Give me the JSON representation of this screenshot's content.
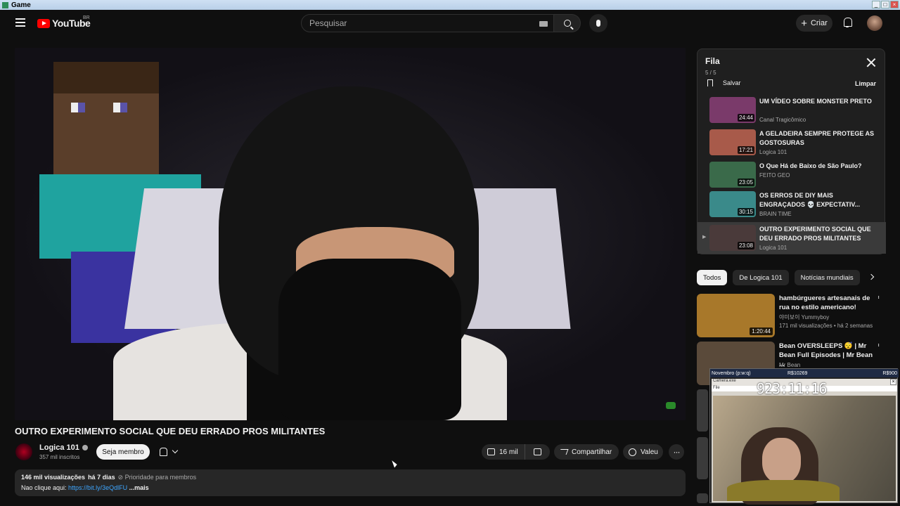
{
  "window": {
    "title": "Game"
  },
  "masthead": {
    "logo_text": "YouTube",
    "country_code": "BR",
    "search_placeholder": "Pesquisar",
    "create_label": "Criar"
  },
  "video": {
    "title": "OUTRO EXPERIMENTO SOCIAL QUE DEU ERRADO PROS MILITANTES",
    "channel_name": "Logica 101",
    "subscribers": "357 mil inscritos",
    "member_button": "Seja membro",
    "likes": "16 mil",
    "share_label": "Compartilhar",
    "thanks_label": "Valeu",
    "views": "146 mil visualizações",
    "date": "há 7 dias",
    "priority": "Prioridade para membros",
    "desc_prefix": "Nao clique aqui: ",
    "desc_link": "https://bit.ly/3eQdlFU",
    "desc_more": " ...mais"
  },
  "queue": {
    "title": "Fila",
    "count": "5 / 5",
    "save_label": "Salvar",
    "clear_label": "Limpar",
    "items": [
      {
        "title": "UM VÍDEO SOBRE MONSTER PRETO",
        "channel": "Canal Tragicômico",
        "duration": "24:44",
        "color": "#7a3a6a"
      },
      {
        "title": "A GELADEIRA SEMPRE PROTEGE AS GOSTOSURAS",
        "channel": "Logica 101",
        "duration": "17:21",
        "color": "#a85a4a"
      },
      {
        "title": "O Que Há de Baixo de São Paulo?",
        "channel": "FEITO GEO",
        "duration": "23:05",
        "color": "#3a6a4a"
      },
      {
        "title": "OS ERROS DE DIY MAIS ENGRAÇADOS 💀 EXPECTATIV...",
        "channel": "BRAIN TIME",
        "duration": "30:15",
        "color": "#3a8a8a"
      },
      {
        "title": "OUTRO EXPERIMENTO SOCIAL QUE DEU ERRADO PROS MILITANTES",
        "channel": "Logica 101",
        "duration": "23:08",
        "color": "#4a3a3a"
      }
    ]
  },
  "chips": [
    "Todos",
    "De Logica 101",
    "Notícias mundiais"
  ],
  "recommendations": [
    {
      "title": "hambúrgueres artesanais de rua no estilo americano!",
      "channel": "야미보이 Yummyboy",
      "meta": "171 mil visualizações • há 2 semanas",
      "duration": "1:20:44",
      "color": "#a8782a"
    },
    {
      "title": "Bean OVERSLEEPS 😴 | Mr Bean Full Episodes | Mr Bean ...",
      "channel": "Mr Bean",
      "meta": "",
      "duration": "",
      "color": "#5a4a3a"
    }
  ],
  "overlay": {
    "header_left": "Novembro (p:w:q)",
    "header_mid": "R$10269",
    "header_right": "R$900",
    "window_title": "Camera.exe",
    "menu": "File",
    "timer": "923:11:16"
  }
}
